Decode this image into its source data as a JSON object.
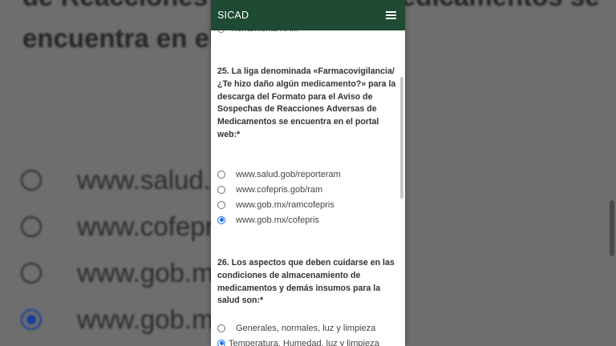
{
  "app": {
    "title": "SICAD"
  },
  "form": {
    "previous_item_fragment": "Herramienta RAM",
    "q25": {
      "text": "25. La liga denominada «Farmacovigilancia/ ¿Te hizo daño algún medicamento?» para la descarga del Formato para el Aviso de Sospechas de Reacciones Adversas de Medicamentos se encuentra en el portal web:*",
      "options": [
        {
          "label": "www.salud.gob/reporteram",
          "checked": false
        },
        {
          "label": "www.cofepris.gob/ram",
          "checked": false
        },
        {
          "label": "www.gob.mx/ramcofepris",
          "checked": false
        },
        {
          "label": "www.gob.mx/cofepris",
          "checked": true
        }
      ]
    },
    "q26": {
      "text": "26. Los aspectos que deben cuidarse en las condiciones de almacenamiento de medicamentos y demás insumos para la salud son:*",
      "options": [
        {
          "label": "Generales, normales, luz y limpieza",
          "checked": false
        },
        {
          "label": "Temperatura, Humedad, luz y limpieza",
          "checked": true
        }
      ]
    }
  },
  "background": {
    "question_fragment": "de Reacciones Adversas de Medicamentos se encuentra en el portal web:*",
    "options": [
      {
        "label": "www.salud.gob/reporteram",
        "checked": false
      },
      {
        "label": "www.cofepris.gob/ram",
        "checked": false
      },
      {
        "label": "www.gob.mx/ramcofepris",
        "checked": false
      },
      {
        "label": "www.gob.mx/cofepris",
        "checked": true
      }
    ]
  },
  "colors": {
    "header": "#1f4a33",
    "radio_checked": "#1a73e8"
  },
  "icons": {
    "menu": "hamburger-menu-icon"
  }
}
